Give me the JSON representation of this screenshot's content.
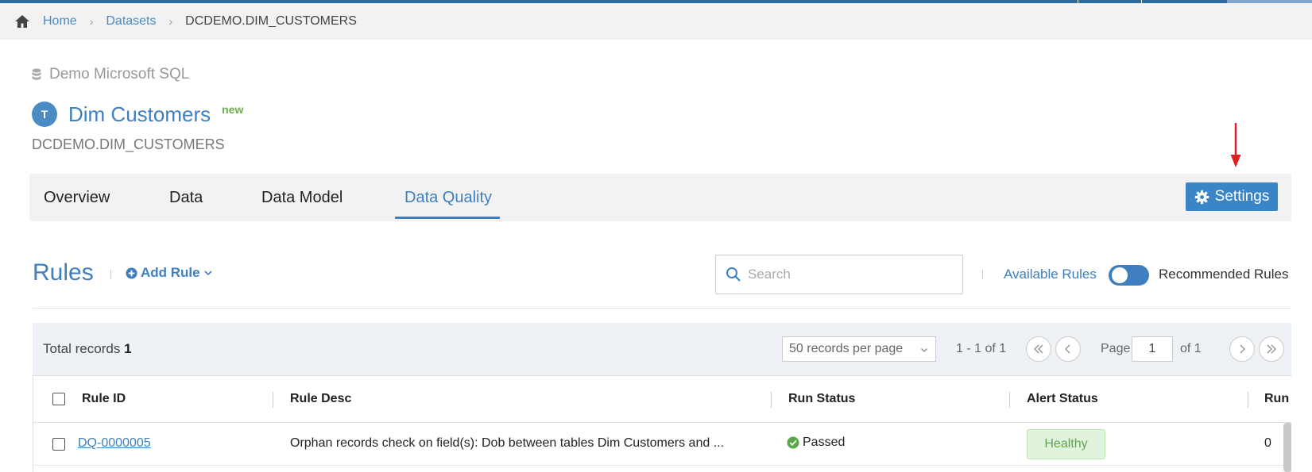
{
  "breadcrumb": {
    "home": "Home",
    "datasets": "Datasets",
    "current": "DCDEMO.DIM_CUSTOMERS"
  },
  "header": {
    "source": "Demo Microsoft SQL",
    "avatar_letter": "T",
    "title": "Dim Customers",
    "badge": "new",
    "full_name": "DCDEMO.DIM_CUSTOMERS"
  },
  "tabs": {
    "items": [
      {
        "label": "Overview"
      },
      {
        "label": "Data"
      },
      {
        "label": "Data Model"
      },
      {
        "label": "Data Quality",
        "active": true
      }
    ],
    "settings_label": "Settings"
  },
  "rules": {
    "title": "Rules",
    "add_rule": "Add Rule",
    "search_placeholder": "Search",
    "available": "Available Rules",
    "recommended": "Recommended Rules"
  },
  "grid": {
    "total_label": "Total records",
    "total_value": "1",
    "per_page": "50 records per page",
    "range": "1 - 1 of 1",
    "page_label": "Page",
    "page_value": "1",
    "of_label": "of 1"
  },
  "table": {
    "columns": [
      "Rule ID",
      "Rule Desc",
      "Run Status",
      "Alert Status",
      "Run"
    ],
    "rows": [
      {
        "rule_id": "DQ-0000005",
        "desc": "Orphan records check on field(s): Dob between tables Dim Customers and ...",
        "run_status": "Passed",
        "alert_status": "Healthy",
        "run": "0"
      }
    ]
  },
  "colors": {
    "accent": "#3f7fbf",
    "button": "#3a85c8",
    "success": "#5ba84a",
    "annotation_arrow": "#e02020"
  }
}
